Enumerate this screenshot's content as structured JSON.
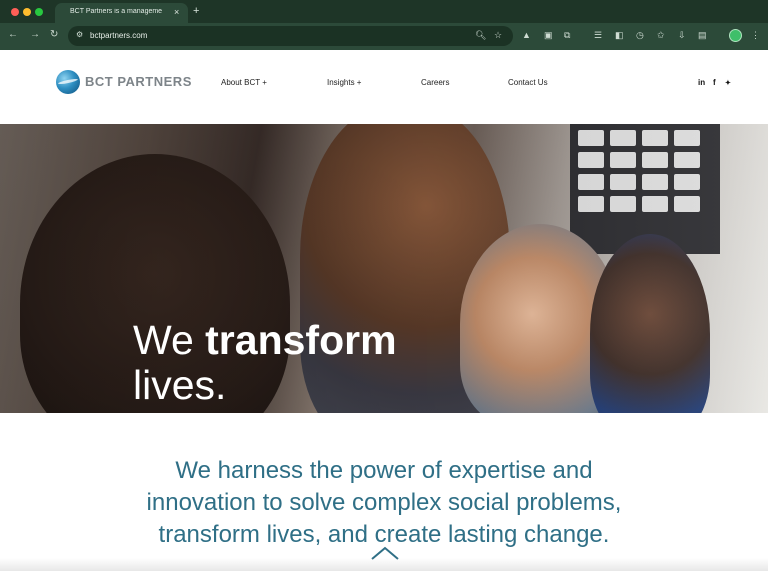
{
  "browser": {
    "tab_title": "BCT Partners is a manageme",
    "tab_close": "×",
    "new_tab": "+",
    "url": "bctpartners.com",
    "back": "←",
    "forward": "→",
    "reload": "↻"
  },
  "header": {
    "logo_text": "BCT PARTNERS",
    "nav": [
      "About BCT +",
      "Insights +",
      "Careers",
      "Contact Us"
    ],
    "social": [
      "in",
      "f",
      "🐦"
    ]
  },
  "hero": {
    "line1_plain": "We ",
    "line1_bold": "transform",
    "line2": "lives."
  },
  "mission": {
    "text": "We harness the power of expertise and innovation to solve complex social problems, transform lives, and create lasting change."
  },
  "colors": {
    "chrome": "#1e3527",
    "accent_text": "#2f6f86",
    "logo_gray": "#7d8489"
  }
}
